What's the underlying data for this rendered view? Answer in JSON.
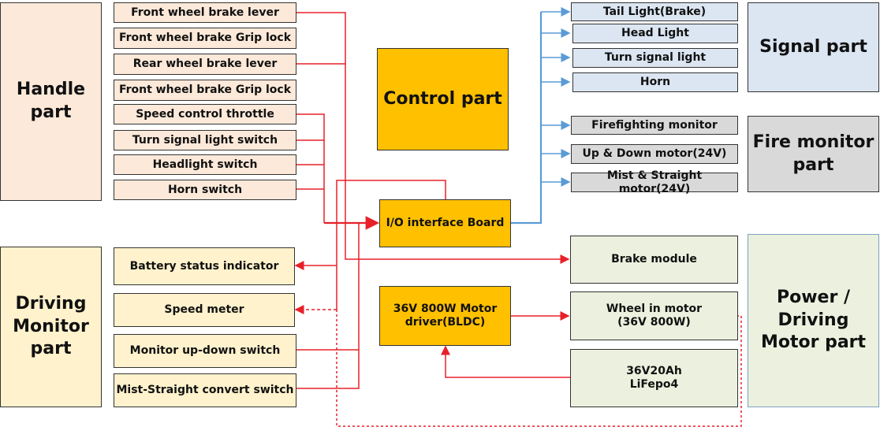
{
  "colors": {
    "control": "#ffc000",
    "handle": "#fde9d9",
    "driving": "#fff2cc",
    "signal": "#dce6f2",
    "fire": "#d9d9d9",
    "power": "#ebf1de",
    "wire_red": "#e8202a",
    "wire_blue": "#5b9bd5"
  },
  "groups": {
    "handle": "Handle part",
    "driving": "Driving Monitor part",
    "control": "Control part",
    "signal": "Signal part",
    "fire": "Fire monitor part",
    "power": "Power / Driving Motor part"
  },
  "handle_items": [
    "Front wheel brake lever",
    "Front wheel brake Grip lock",
    "Rear wheel brake lever",
    "Front wheel brake Grip lock",
    "Speed control throttle",
    "Turn signal light switch",
    "Headlight switch",
    "Horn switch"
  ],
  "driving_items": [
    "Battery status indicator",
    "Speed meter",
    "Monitor up-down switch",
    "Mist-Straight convert switch"
  ],
  "control_items": {
    "io": "I/O interface Board",
    "driver": "36V 800W Motor driver(BLDC)"
  },
  "signal_items": [
    "Tail Light(Brake)",
    "Head Light",
    "Turn signal light",
    "Horn"
  ],
  "fire_items": [
    "Firefighting monitor",
    "Up & Down motor(24V)",
    "Mist & Straight motor(24V)"
  ],
  "power_items": [
    "Brake module",
    "Wheel in motor (36V 800W)",
    "36V20Ah LiFepo4"
  ]
}
